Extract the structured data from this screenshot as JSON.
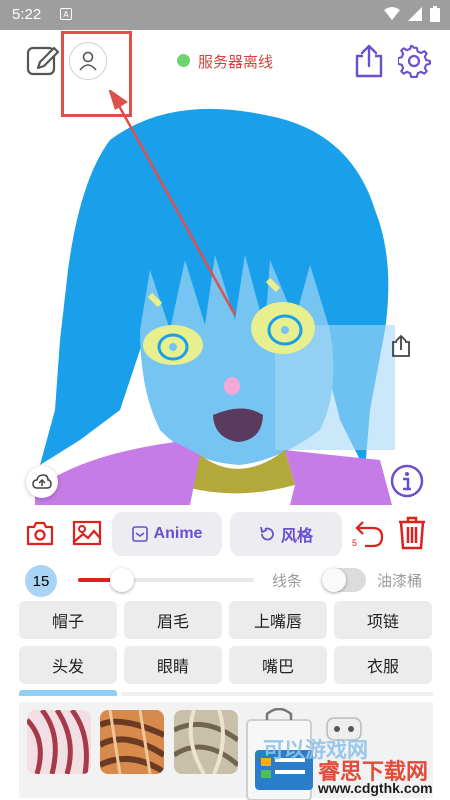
{
  "status_bar": {
    "time": "5:22",
    "notification_glyph": "A"
  },
  "top_bar": {
    "server_status": "服务器离线",
    "server_status_color": "#6fd46f",
    "icons": [
      "edit-canvas-icon",
      "account-icon",
      "share-icon",
      "settings-icon",
      "coffee-icon"
    ]
  },
  "canvas": {
    "icons": [
      "share-icon",
      "cloud-upload-icon",
      "info-icon"
    ]
  },
  "toolbar": {
    "anime_label": "Anime",
    "style_label": "风格",
    "undo_count": "5",
    "accent": "#6a4fcf",
    "danger": "#e0201a"
  },
  "brush": {
    "size": "15",
    "size_fraction": 0.25,
    "line_mode_label": "线条",
    "bucket_mode_label": "油漆桶",
    "bucket_enabled": false
  },
  "parts": [
    {
      "label": "帽子"
    },
    {
      "label": "眉毛"
    },
    {
      "label": "上嘴唇"
    },
    {
      "label": "项链"
    },
    {
      "label": "头发"
    },
    {
      "label": "眼睛"
    },
    {
      "label": "嘴巴"
    },
    {
      "label": "衣服"
    }
  ],
  "watermark": {
    "line1": "可以游戏网",
    "line2": "睿思下载网",
    "line3": "www.cdgthk.com"
  }
}
